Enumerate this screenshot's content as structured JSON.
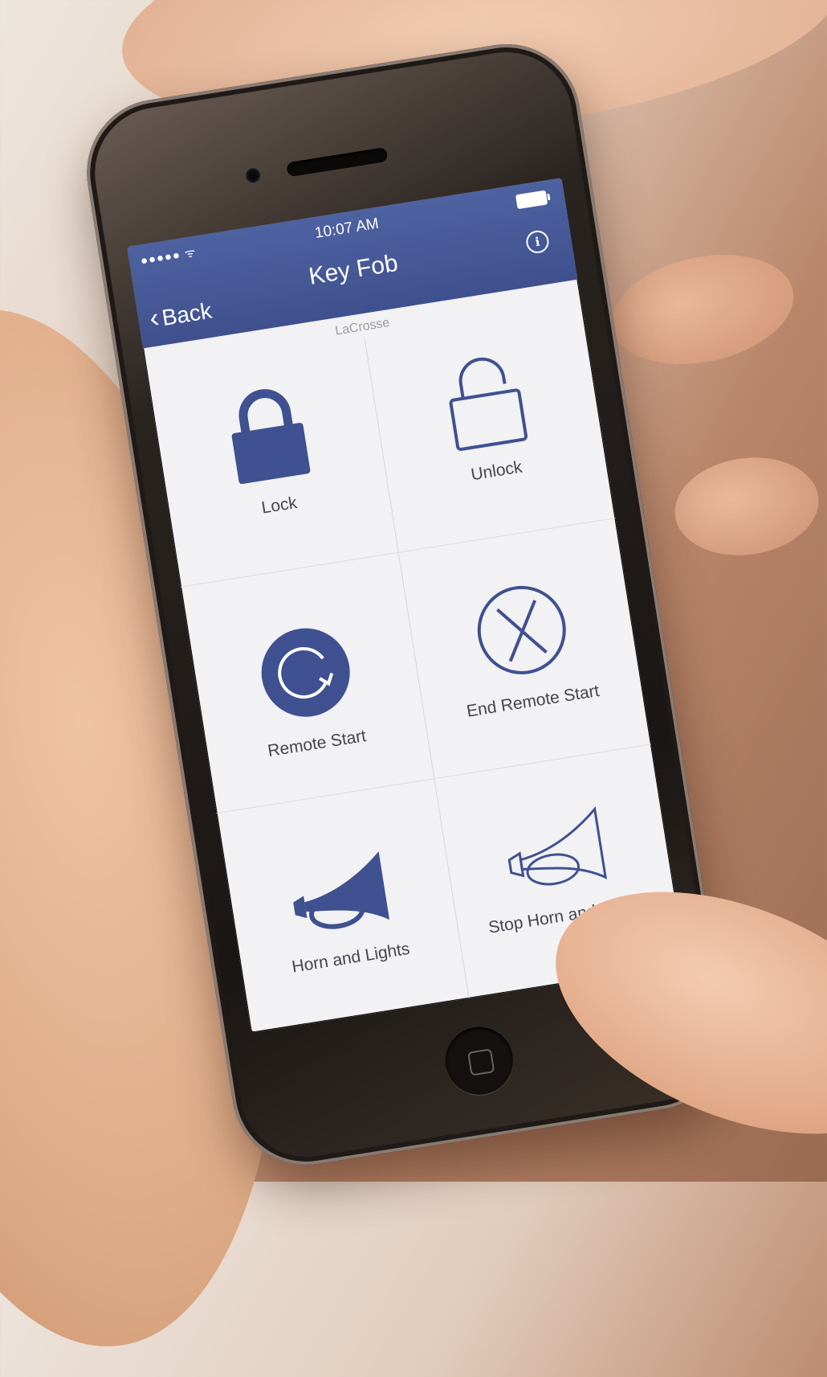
{
  "status_bar": {
    "signal": "●●●●● ᯤ",
    "time": "10:07 AM"
  },
  "nav": {
    "back_label": "Back",
    "title": "Key Fob",
    "subtitle": "LaCrosse"
  },
  "actions": [
    {
      "label": "Lock",
      "icon": "lock-closed-icon"
    },
    {
      "label": "Unlock",
      "icon": "lock-open-icon"
    },
    {
      "label": "Remote Start",
      "icon": "remote-start-icon"
    },
    {
      "label": "End Remote Start",
      "icon": "end-remote-start-icon"
    },
    {
      "label": "Horn and Lights",
      "icon": "horn-filled-icon"
    },
    {
      "label": "Stop Horn and Lights",
      "icon": "horn-outline-icon"
    }
  ],
  "colors": {
    "nav_bar": "#4e62a1",
    "icon_blue": "#3f5190",
    "screen_bg": "#f2f2f4"
  }
}
